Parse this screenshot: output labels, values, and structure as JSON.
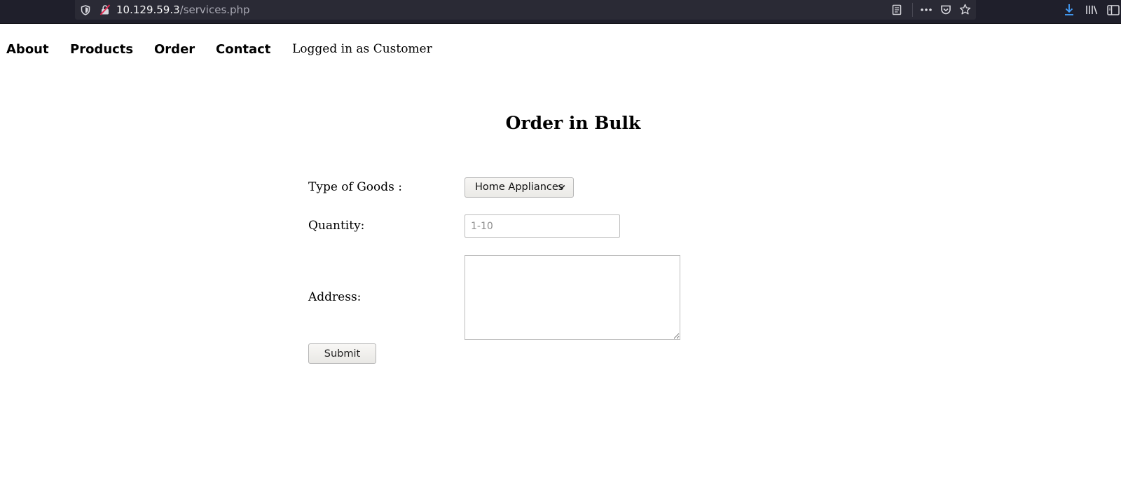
{
  "browser": {
    "url_host": "10.129.59.3",
    "url_path": "/services.php",
    "icons": {
      "tracking": "shield-icon",
      "security": "insecure-lock-icon",
      "reader": "reader-view-icon",
      "more": "more-actions-icon",
      "pocket": "pocket-icon",
      "bookmark": "star-icon",
      "downloads": "download-arrow-icon",
      "library": "library-icon",
      "sidebar": "sidebar-icon"
    },
    "colors": {
      "toolbar": "#1f1f2b",
      "urlbar": "#2a2a35",
      "download_accent": "#45a1ff",
      "insecure_accent": "#e22850"
    }
  },
  "nav": {
    "items": [
      {
        "label": "About"
      },
      {
        "label": "Products"
      },
      {
        "label": "Order"
      },
      {
        "label": "Contact"
      }
    ],
    "status": "Logged in as Customer"
  },
  "form": {
    "title": "Order in Bulk",
    "type_label": "Type of Goods :",
    "type_selected": "Home Appliances",
    "quantity_label": "Quantity:",
    "quantity_value": "",
    "quantity_placeholder": "1-10",
    "address_label": "Address:",
    "address_value": "",
    "submit_label": "Submit"
  }
}
